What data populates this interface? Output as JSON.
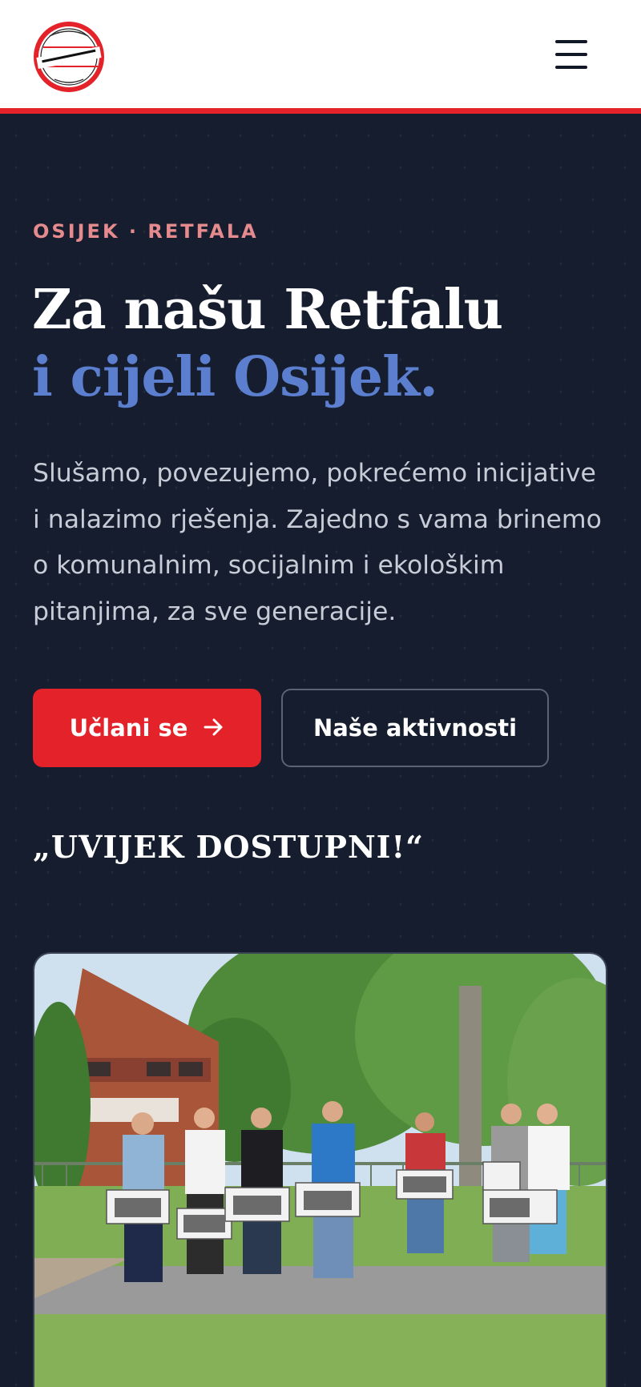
{
  "header": {
    "logo": {
      "name": "logo-seal",
      "text_top": "NEZAVISNA LISTA",
      "text_main": "TOMISLAVA MIŠETIĆA",
      "text_bottom": "OSIJEK"
    },
    "menu_icon": "hamburger-menu-icon"
  },
  "hero": {
    "eyebrow": "OSIJEK · RETFALA",
    "title_line1": "Za našu Retfalu",
    "title_line2": "i cijeli Osijek.",
    "lead": "Slušamo, povezujemo, pokrećemo inicijative i nalazimo rješenja. Zajedno s vama brinemo o komunalnim, socijalnim i ekološkim pitanjima, za sve generacije.",
    "primary_button": "Učlani se",
    "primary_button_icon": "arrow-right-icon",
    "secondary_button": "Naše aktivnosti",
    "slogan": "„UVIJEK DOSTUPNI!“"
  },
  "photo": {
    "subject": "group-photo"
  },
  "colors": {
    "accent_red": "#e3222a",
    "navy_bg": "#151d2e",
    "accent_blue": "#5b7fce",
    "eyebrow_pink": "#e58a8d"
  }
}
